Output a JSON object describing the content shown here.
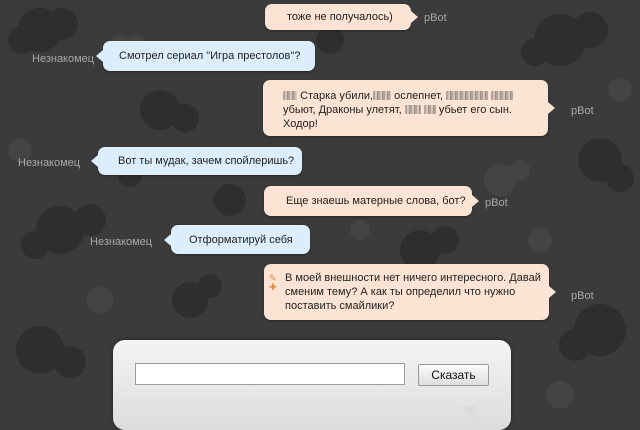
{
  "messages": [
    {
      "speaker": "pBot",
      "text": "тоже не получалось)"
    },
    {
      "speaker": "Незнакомец",
      "text": "Смотрел сериал \"Игра престолов\"?"
    },
    {
      "speaker": "pBot",
      "parts": [
        "Старка убили,",
        "ослепнет,",
        "убьют, Драконы улетят,",
        "убьет его сын. Ходор!"
      ]
    },
    {
      "speaker": "Незнакомец",
      "text": "Вот ты мудак, зачем спойлеришь?"
    },
    {
      "speaker": "pBot",
      "text": "Еще знаешь матерные слова, бот?"
    },
    {
      "speaker": "Незнакомец",
      "text": "Отформатируй себя"
    },
    {
      "speaker": "pBot",
      "lines": [
        "В моей внешности нет ничего интересного. Давай",
        "сменим тему? А как ты определил что нужно",
        "поставить смайлики?"
      ]
    }
  ],
  "input": {
    "value": "",
    "placeholder": ""
  },
  "send_button": {
    "label": "Сказать"
  },
  "colors": {
    "background": "#3b3b3b",
    "bot_bubble": "#fbe4d3",
    "human_bubble": "#dceefc",
    "speaker_text": "#a8a8a8"
  }
}
